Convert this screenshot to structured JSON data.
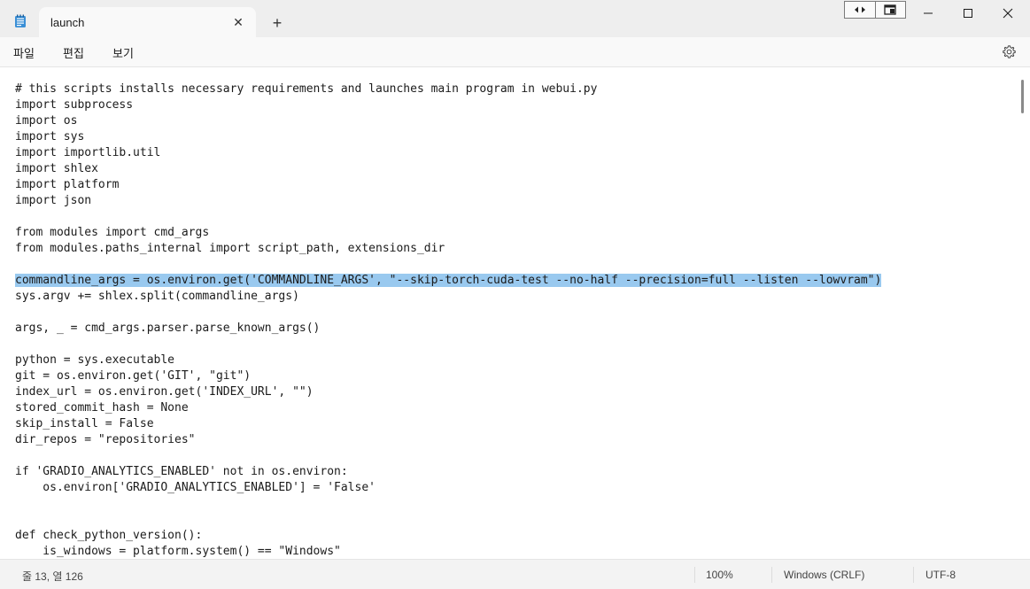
{
  "window": {
    "tab_title": "launch",
    "tab_close_glyph": "✕",
    "new_tab_glyph": "+",
    "icons": {
      "app": "notepad-icon",
      "minimize": "minimize-icon",
      "maximize": "maximize-icon",
      "close": "close-icon",
      "snap_left": "snap-arrows-icon",
      "snap_right": "snap-window-icon"
    }
  },
  "menu": {
    "items": [
      "파일",
      "편집",
      "보기"
    ],
    "settings_icon": "gear-icon"
  },
  "editor": {
    "selected_line_index": 12,
    "selection_color": "#99c9ef",
    "lines": [
      "# this scripts installs necessary requirements and launches main program in webui.py",
      "import subprocess",
      "import os",
      "import sys",
      "import importlib.util",
      "import shlex",
      "import platform",
      "import json",
      "",
      "from modules import cmd_args",
      "from modules.paths_internal import script_path, extensions_dir",
      "",
      "commandline_args = os.environ.get('COMMANDLINE_ARGS', \"--skip-torch-cuda-test --no-half --precision=full --listen --lowvram\")",
      "sys.argv += shlex.split(commandline_args)",
      "",
      "args, _ = cmd_args.parser.parse_known_args()",
      "",
      "python = sys.executable",
      "git = os.environ.get('GIT', \"git\")",
      "index_url = os.environ.get('INDEX_URL', \"\")",
      "stored_commit_hash = None",
      "skip_install = False",
      "dir_repos = \"repositories\"",
      "",
      "if 'GRADIO_ANALYTICS_ENABLED' not in os.environ:",
      "    os.environ['GRADIO_ANALYTICS_ENABLED'] = 'False'",
      "",
      "",
      "def check_python_version():",
      "    is_windows = platform.system() == \"Windows\""
    ]
  },
  "status": {
    "position": "줄 13, 열 126",
    "zoom": "100%",
    "line_ending": "Windows (CRLF)",
    "encoding": "UTF-8"
  }
}
